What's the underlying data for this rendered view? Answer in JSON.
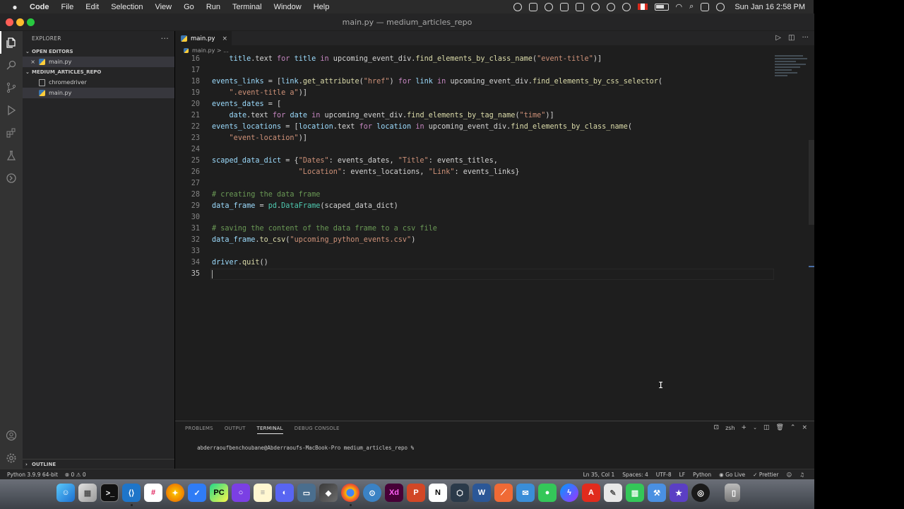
{
  "menubar": {
    "app_name": "Code",
    "items": [
      "File",
      "Edit",
      "Selection",
      "View",
      "Go",
      "Run",
      "Terminal",
      "Window",
      "Help"
    ],
    "clock": "Sun Jan 16  2:58 PM"
  },
  "window": {
    "title": "main.py — medium_articles_repo"
  },
  "sidebar": {
    "header": "EXPLORER",
    "open_editors_label": "OPEN EDITORS",
    "open_editors": [
      {
        "name": "main.py"
      }
    ],
    "repo_label": "MEDIUM_ARTICLES_REPO",
    "files": [
      {
        "name": "chromedriver"
      },
      {
        "name": "main.py"
      }
    ],
    "outline_label": "OUTLINE"
  },
  "editor": {
    "tab_label": "main.py",
    "breadcrumb": "main.py > ...",
    "lines": [
      {
        "n": "16",
        "tokens": [
          [
            "p",
            "    "
          ],
          [
            "v",
            "title"
          ],
          [
            "p",
            ".text "
          ],
          [
            "k",
            "for"
          ],
          [
            "p",
            " "
          ],
          [
            "v",
            "title"
          ],
          [
            "p",
            " "
          ],
          [
            "k",
            "in"
          ],
          [
            "p",
            " upcoming_event_div."
          ],
          [
            "f",
            "find_elements_by_class_name"
          ],
          [
            "p",
            "("
          ],
          [
            "s",
            "\"event-title\""
          ],
          [
            "p",
            ")]"
          ]
        ]
      },
      {
        "n": "17",
        "tokens": []
      },
      {
        "n": "18",
        "tokens": [
          [
            "v",
            "events_links"
          ],
          [
            "p",
            " = ["
          ],
          [
            "v",
            "link"
          ],
          [
            "p",
            "."
          ],
          [
            "f",
            "get_attribute"
          ],
          [
            "p",
            "("
          ],
          [
            "s",
            "\"href\""
          ],
          [
            "p",
            ") "
          ],
          [
            "k",
            "for"
          ],
          [
            "p",
            " "
          ],
          [
            "v",
            "link"
          ],
          [
            "p",
            " "
          ],
          [
            "k",
            "in"
          ],
          [
            "p",
            " upcoming_event_div."
          ],
          [
            "f",
            "find_elements_by_css_selector"
          ],
          [
            "p",
            "("
          ]
        ]
      },
      {
        "n": "19",
        "tokens": [
          [
            "p",
            "    "
          ],
          [
            "s",
            "\".event-title a\""
          ],
          [
            "p",
            ")]"
          ]
        ]
      },
      {
        "n": "20",
        "tokens": [
          [
            "v",
            "events_dates"
          ],
          [
            "p",
            " = ["
          ]
        ]
      },
      {
        "n": "21",
        "tokens": [
          [
            "p",
            "    "
          ],
          [
            "v",
            "date"
          ],
          [
            "p",
            ".text "
          ],
          [
            "k",
            "for"
          ],
          [
            "p",
            " "
          ],
          [
            "v",
            "date"
          ],
          [
            "p",
            " "
          ],
          [
            "k",
            "in"
          ],
          [
            "p",
            " upcoming_event_div."
          ],
          [
            "f",
            "find_elements_by_tag_name"
          ],
          [
            "p",
            "("
          ],
          [
            "s",
            "\"time\""
          ],
          [
            "p",
            ")]"
          ]
        ]
      },
      {
        "n": "22",
        "tokens": [
          [
            "v",
            "events_locations"
          ],
          [
            "p",
            " = ["
          ],
          [
            "v",
            "location"
          ],
          [
            "p",
            ".text "
          ],
          [
            "k",
            "for"
          ],
          [
            "p",
            " "
          ],
          [
            "v",
            "location"
          ],
          [
            "p",
            " "
          ],
          [
            "k",
            "in"
          ],
          [
            "p",
            " upcoming_event_div."
          ],
          [
            "f",
            "find_elements_by_class_name"
          ],
          [
            "p",
            "("
          ]
        ]
      },
      {
        "n": "23",
        "tokens": [
          [
            "p",
            "    "
          ],
          [
            "s",
            "\"event-location\""
          ],
          [
            "p",
            ")]"
          ]
        ]
      },
      {
        "n": "24",
        "tokens": []
      },
      {
        "n": "25",
        "tokens": [
          [
            "v",
            "scaped_data_dict"
          ],
          [
            "p",
            " = {"
          ],
          [
            "s",
            "\"Dates\""
          ],
          [
            "p",
            ": events_dates, "
          ],
          [
            "s",
            "\"Title\""
          ],
          [
            "p",
            ": events_titles,"
          ]
        ]
      },
      {
        "n": "26",
        "tokens": [
          [
            "p",
            "                    "
          ],
          [
            "s",
            "\"Location\""
          ],
          [
            "p",
            ": events_locations, "
          ],
          [
            "s",
            "\"Link\""
          ],
          [
            "p",
            ": events_links}"
          ]
        ]
      },
      {
        "n": "27",
        "tokens": []
      },
      {
        "n": "28",
        "tokens": [
          [
            "c",
            "# creating the data frame"
          ]
        ]
      },
      {
        "n": "29",
        "tokens": [
          [
            "v",
            "data_frame"
          ],
          [
            "p",
            " = "
          ],
          [
            "t",
            "pd"
          ],
          [
            "p",
            "."
          ],
          [
            "t",
            "DataFrame"
          ],
          [
            "p",
            "(scaped_data_dict)"
          ]
        ]
      },
      {
        "n": "30",
        "tokens": []
      },
      {
        "n": "31",
        "tokens": [
          [
            "c",
            "# saving the content of the data frame to a csv file"
          ]
        ]
      },
      {
        "n": "32",
        "tokens": [
          [
            "v",
            "data_frame"
          ],
          [
            "p",
            "."
          ],
          [
            "f",
            "to_csv"
          ],
          [
            "p",
            "("
          ],
          [
            "s",
            "\"upcoming_python_events.csv\""
          ],
          [
            "p",
            ")"
          ]
        ]
      },
      {
        "n": "33",
        "tokens": []
      },
      {
        "n": "34",
        "tokens": [
          [
            "v",
            "driver"
          ],
          [
            "p",
            "."
          ],
          [
            "f",
            "quit"
          ],
          [
            "p",
            "()"
          ]
        ]
      },
      {
        "n": "35",
        "tokens": []
      }
    ],
    "current_line": "35"
  },
  "panel": {
    "tabs": [
      "PROBLEMS",
      "OUTPUT",
      "TERMINAL",
      "DEBUG CONSOLE"
    ],
    "active_tab": "TERMINAL",
    "shell": "zsh",
    "prompt": "abderraoufbenchoubane@Abderraoufs-MacBook-Pro medium_articles_repo %"
  },
  "statusbar": {
    "interpreter": "Python 3.9.9 64-bit",
    "problems": "⊗ 0  ⚠ 0",
    "position": "Ln 35, Col 1",
    "spaces": "Spaces: 4",
    "encoding": "UTF-8",
    "eol": "LF",
    "language": "Python",
    "golive": "Go Live",
    "prettier": "Prettier"
  },
  "colors": {
    "accent": "#007acc",
    "keyword": "#c586c0",
    "function": "#dcdcaa",
    "string": "#ce9178",
    "comment": "#6a9955",
    "variable": "#9cdcfe",
    "type": "#4ec9b0"
  },
  "icons": [
    "apple-icon",
    "explorer-icon",
    "search-icon",
    "source-control-icon",
    "run-debug-icon",
    "extensions-icon",
    "testing-icon",
    "remote-icon",
    "account-icon",
    "settings-gear-icon",
    "python-file-icon",
    "file-icon",
    "run-icon",
    "split-editor-icon",
    "more-icon",
    "close-icon",
    "add-terminal-icon",
    "trash-icon",
    "maximize-icon"
  ]
}
